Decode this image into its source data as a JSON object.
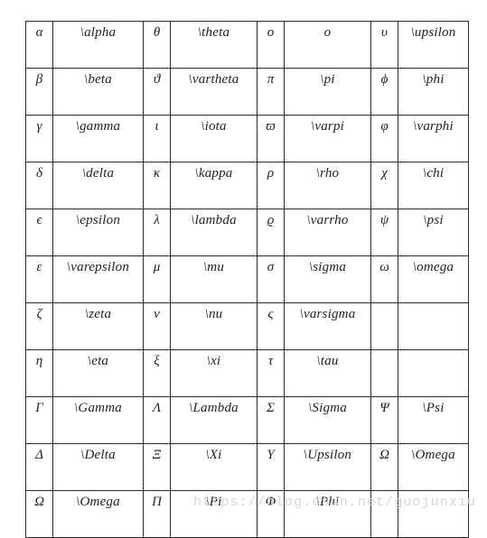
{
  "table": {
    "name": "latex-greek-letters-table",
    "columns": 8,
    "row_count": 11,
    "rows": [
      [
        {
          "symbol": "α",
          "command": "\\alpha"
        },
        {
          "symbol": "θ",
          "command": "\\theta"
        },
        {
          "symbol": "o",
          "command": "o"
        },
        {
          "symbol": "υ",
          "command": "\\upsilon"
        }
      ],
      [
        {
          "symbol": "β",
          "command": "\\beta"
        },
        {
          "symbol": "ϑ",
          "command": "\\vartheta"
        },
        {
          "symbol": "π",
          "command": "\\pi"
        },
        {
          "symbol": "ϕ",
          "command": "\\phi"
        }
      ],
      [
        {
          "symbol": "γ",
          "command": "\\gamma"
        },
        {
          "symbol": "ι",
          "command": "\\iota"
        },
        {
          "symbol": "ϖ",
          "command": "\\varpi"
        },
        {
          "symbol": "φ",
          "command": "\\varphi"
        }
      ],
      [
        {
          "symbol": "δ",
          "command": "\\delta"
        },
        {
          "symbol": "κ",
          "command": "\\kappa"
        },
        {
          "symbol": "ρ",
          "command": "\\rho"
        },
        {
          "symbol": "χ",
          "command": "\\chi"
        }
      ],
      [
        {
          "symbol": "ϵ",
          "command": "\\epsilon"
        },
        {
          "symbol": "λ",
          "command": "\\lambda"
        },
        {
          "symbol": "ϱ",
          "command": "\\varrho"
        },
        {
          "symbol": "ψ",
          "command": "\\psi"
        }
      ],
      [
        {
          "symbol": "ε",
          "command": "\\varepsilon"
        },
        {
          "symbol": "μ",
          "command": "\\mu"
        },
        {
          "symbol": "σ",
          "command": "\\sigma"
        },
        {
          "symbol": "ω",
          "command": "\\omega"
        }
      ],
      [
        {
          "symbol": "ζ",
          "command": "\\zeta"
        },
        {
          "symbol": "ν",
          "command": "\\nu"
        },
        {
          "symbol": "ς",
          "command": "\\varsigma"
        },
        {
          "symbol": "",
          "command": ""
        }
      ],
      [
        {
          "symbol": "η",
          "command": "\\eta"
        },
        {
          "symbol": "ξ",
          "command": "\\xi"
        },
        {
          "symbol": "τ",
          "command": "\\tau"
        },
        {
          "symbol": "",
          "command": ""
        }
      ],
      [
        {
          "symbol": "Γ",
          "command": "\\Gamma"
        },
        {
          "symbol": "Λ",
          "command": "\\Lambda"
        },
        {
          "symbol": "Σ",
          "command": "\\Sigma"
        },
        {
          "symbol": "Ψ",
          "command": "\\Psi"
        }
      ],
      [
        {
          "symbol": "Δ",
          "command": "\\Delta"
        },
        {
          "symbol": "Ξ",
          "command": "\\Xi"
        },
        {
          "symbol": "Υ",
          "command": "\\Upsilon"
        },
        {
          "symbol": "Ω",
          "command": "\\Omega"
        }
      ],
      [
        {
          "symbol": "Ω",
          "command": "\\Omega"
        },
        {
          "symbol": "Π",
          "command": "\\Pi"
        },
        {
          "symbol": "Φ",
          "command": "\\Phi"
        },
        {
          "symbol": "",
          "command": ""
        }
      ]
    ]
  },
  "watermark": {
    "text": "https://blog.csdn.net/guojunxiu"
  },
  "colors": {
    "background": "#ffffff",
    "border": "#2b2b2b",
    "text": "#1f1f1f",
    "watermark": "#d8d8d8"
  }
}
